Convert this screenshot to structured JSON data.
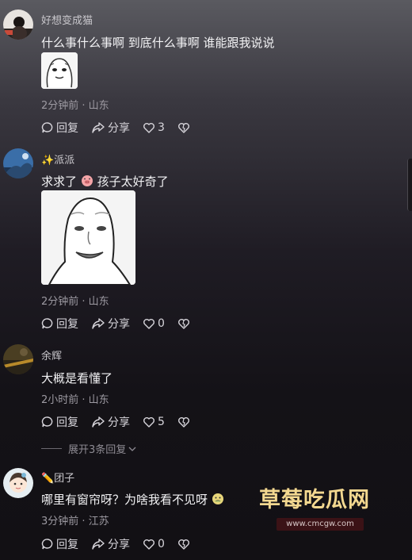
{
  "comments": [
    {
      "username": "好想变成猫",
      "text": "什么事什么事啊  到底什么事啊  谁能跟我说说",
      "meta": "2分钟前 · 山东",
      "reply_label": "回复",
      "share_label": "分享",
      "like_count": "3"
    },
    {
      "username": "✨派派",
      "text_part1": "求求了",
      "text_part2": "孩子太好奇了",
      "meta": "2分钟前 · 山东",
      "reply_label": "回复",
      "share_label": "分享",
      "like_count": "0"
    },
    {
      "username": "余辉",
      "text": "大概是看懂了",
      "meta": "2小时前 · 山东",
      "reply_label": "回复",
      "share_label": "分享",
      "like_count": "5",
      "expand_label": "展开3条回复"
    },
    {
      "username": "✏️团子",
      "text": "哪里有窗帘呀？为啥我看不见呀",
      "meta": "3分钟前 · 江苏",
      "reply_label": "回复",
      "share_label": "分享",
      "like_count": "0"
    }
  ],
  "watermark": {
    "title": "草莓吃瓜网",
    "url": "www.cmcgw.com"
  },
  "colors": {
    "watermark_gold": "#f3d890",
    "watermark_bg": "#3b1216"
  }
}
